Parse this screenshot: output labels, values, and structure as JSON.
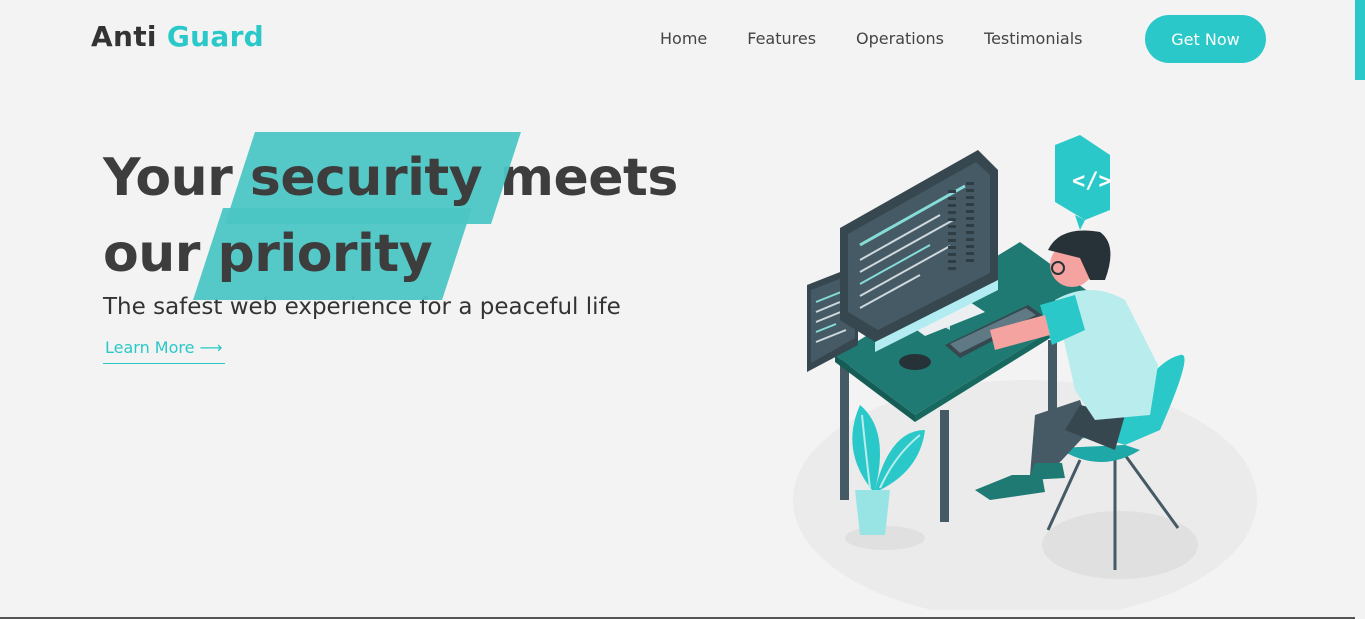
{
  "header": {
    "logo_part1": "Anti",
    "logo_part2": "Guard",
    "nav": [
      "Home",
      "Features",
      "Operations",
      "Testimonials"
    ],
    "cta_label": "Get Now"
  },
  "hero": {
    "line1_a": "Your",
    "line1_highlight": "security",
    "line1_b": "meets",
    "line2_a": "our",
    "line2_highlight": "priority",
    "subtitle": "The safest web experience for a peaceful life",
    "learn_more": "Learn More ⟶"
  },
  "colors": {
    "accent": "#2ac8c8",
    "background": "#f3f3f3",
    "text": "#3d3d3d"
  }
}
